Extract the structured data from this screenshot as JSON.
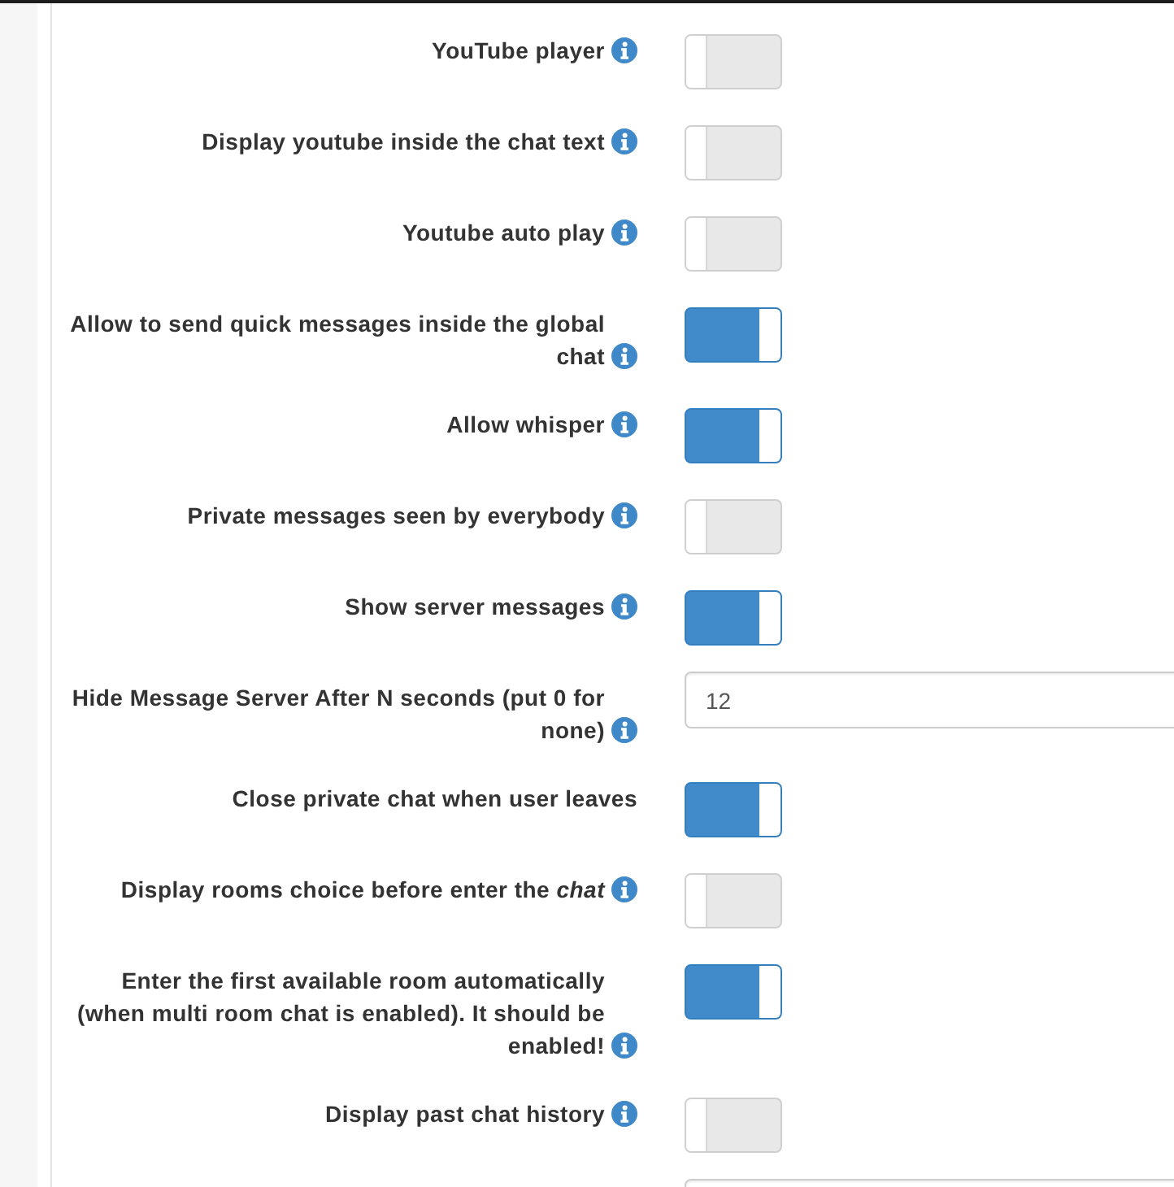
{
  "settings": [
    {
      "kind": "toggle",
      "label": "YouTube player",
      "info": true,
      "on": false
    },
    {
      "kind": "toggle",
      "label": "Display youtube inside the chat text",
      "info": true,
      "on": false
    },
    {
      "kind": "toggle",
      "label": "Youtube auto play",
      "info": true,
      "on": false
    },
    {
      "kind": "toggle",
      "label": "Allow to send quick messages inside the global chat",
      "info": true,
      "on": true
    },
    {
      "kind": "toggle",
      "label": "Allow whisper",
      "info": true,
      "on": true
    },
    {
      "kind": "toggle",
      "label": "Private messages seen by everybody",
      "info": true,
      "on": false
    },
    {
      "kind": "toggle",
      "label": "Show server messages",
      "info": true,
      "on": true
    },
    {
      "kind": "input",
      "label": "Hide Message Server After N seconds (put 0 for none)",
      "info": true,
      "value": "12"
    },
    {
      "kind": "toggle",
      "label": "Close private chat when user leaves",
      "info": false,
      "on": true
    },
    {
      "kind": "toggle",
      "label": "Display rooms choice before enter the *chat*",
      "info": true,
      "on": false
    },
    {
      "kind": "toggle",
      "label": "Enter the first available room automatically (when multi room chat is enabled). It should be enabled!",
      "info": true,
      "on": true
    },
    {
      "kind": "toggle",
      "label": "Display past chat history",
      "info": true,
      "on": false
    },
    {
      "kind": "input"
    }
  ]
}
